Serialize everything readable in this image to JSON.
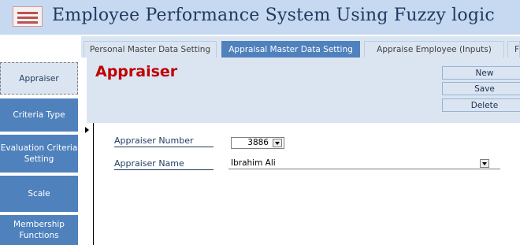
{
  "app": {
    "title": "Employee Performance System Using Fuzzy logic",
    "icon": "form-icon"
  },
  "tabs": [
    {
      "label": "Personal Master Data Setting",
      "active": false
    },
    {
      "label": "Appraisal Master Data Setting",
      "active": true
    },
    {
      "label": "Appraise Employee (Inputs)",
      "active": false
    },
    {
      "label": "F",
      "active": false
    }
  ],
  "sidebar": {
    "items": [
      {
        "label": "Appraiser",
        "active": true
      },
      {
        "label": "Criteria Type",
        "active": false
      },
      {
        "label": "Evaluation Criteria Setting",
        "active": false
      },
      {
        "label": "Scale",
        "active": false
      },
      {
        "label": "Membership Functions",
        "active": false
      }
    ]
  },
  "form": {
    "title": "Appraiser",
    "buttons": {
      "new": "New",
      "save": "Save",
      "delete": "Delete"
    },
    "fields": {
      "number": {
        "label": "Appraiser Number",
        "value": "3886"
      },
      "name": {
        "label": "Appraiser Name",
        "value": "Ibrahim Ali"
      }
    }
  },
  "colors": {
    "accent": "#4f81bd",
    "title_red": "#c00000",
    "panel": "#dbe5f1",
    "header": "#c6d9f1"
  }
}
